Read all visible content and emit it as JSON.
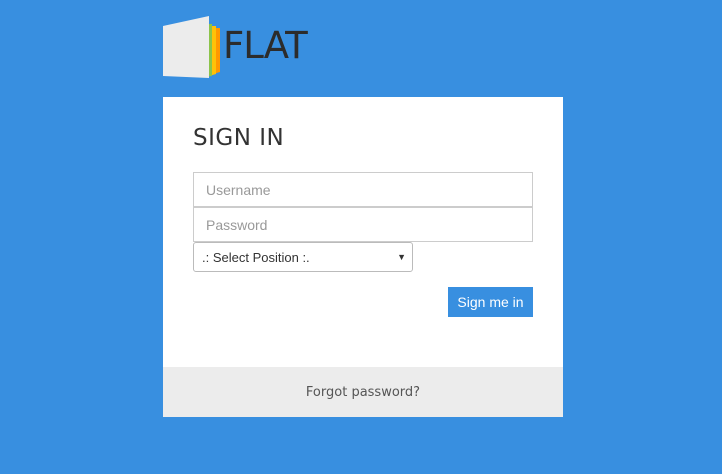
{
  "logo": {
    "text": "FLAT",
    "stripe_colors": [
      "#8bc34a",
      "#ffc107",
      "#ff9800"
    ]
  },
  "form": {
    "title": "SIGN IN",
    "username_placeholder": "Username",
    "password_placeholder": "Password",
    "position_select": {
      "selected": ".: Select Position :."
    },
    "submit_label": "Sign me in",
    "forgot_label": "Forgot password?"
  },
  "colors": {
    "background": "#388fe0",
    "accent": "#388fe0",
    "card": "#ffffff",
    "footer": "#ececec"
  }
}
